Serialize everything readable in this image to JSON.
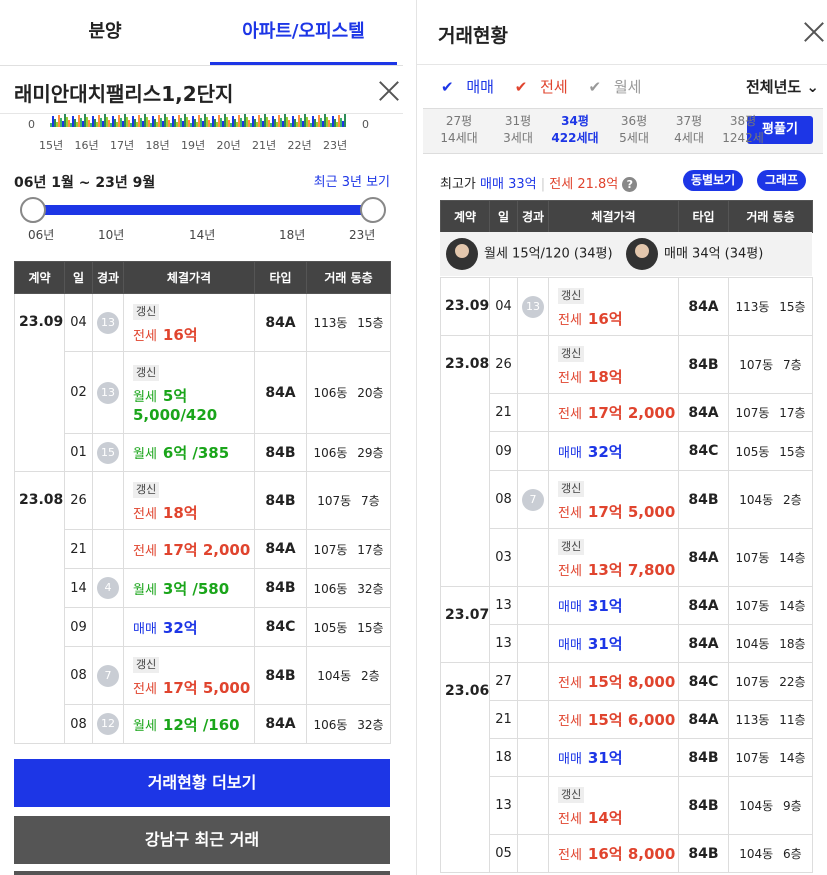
{
  "tabs": {
    "presale": "분양",
    "apt": "아파트/오피스텔"
  },
  "apt_name": "래미안대치팰리스1,2단지",
  "histogram": {
    "axis_min": "0",
    "axis_max": "0",
    "years": [
      "15년",
      "16년",
      "17년",
      "18년",
      "19년",
      "20년",
      "21년",
      "22년",
      "23년"
    ]
  },
  "slider": {
    "range_text": "06년 1월 ~ 23년 9월",
    "recent_link": "최근 3년 보기",
    "labels": [
      "06년",
      "10년",
      "14년",
      "18년",
      "23년"
    ]
  },
  "table_headers": {
    "contract": "계약",
    "day": "일",
    "elapsed": "경과",
    "price": "체결가격",
    "type": "타입",
    "dongfloor": "거래 동층"
  },
  "left_rows": [
    {
      "month": "23.09",
      "day": "04",
      "elapsed": "13",
      "renew": "갱신",
      "kind": "전세",
      "price": "16억",
      "price2": "",
      "cls": "jeon",
      "type": "84A",
      "dong": "113동",
      "floor": "15층"
    },
    {
      "month": "",
      "day": "02",
      "elapsed": "13",
      "renew": "갱신",
      "kind": "월세",
      "price": "5억",
      "price2": "5,000/420",
      "cls": "wol",
      "type": "84A",
      "dong": "106동",
      "floor": "20층"
    },
    {
      "month": "",
      "day": "01",
      "elapsed": "15",
      "renew": "",
      "kind": "월세",
      "price": "6억 /385",
      "price2": "",
      "cls": "wol",
      "type": "84B",
      "dong": "106동",
      "floor": "29층"
    },
    {
      "month": "23.08",
      "day": "26",
      "elapsed": "",
      "renew": "갱신",
      "kind": "전세",
      "price": "18억",
      "price2": "",
      "cls": "jeon",
      "type": "84B",
      "dong": "107동",
      "floor": "7층"
    },
    {
      "month": "",
      "day": "21",
      "elapsed": "",
      "renew": "",
      "kind": "전세",
      "price": "17억 2,000",
      "price2": "",
      "cls": "jeon",
      "type": "84A",
      "dong": "107동",
      "floor": "17층"
    },
    {
      "month": "",
      "day": "14",
      "elapsed": "4",
      "renew": "",
      "kind": "월세",
      "price": "3억 /580",
      "price2": "",
      "cls": "wol",
      "type": "84B",
      "dong": "106동",
      "floor": "32층"
    },
    {
      "month": "",
      "day": "09",
      "elapsed": "",
      "renew": "",
      "kind": "매매",
      "price": "32억",
      "price2": "",
      "cls": "mae",
      "type": "84C",
      "dong": "105동",
      "floor": "15층"
    },
    {
      "month": "",
      "day": "08",
      "elapsed": "7",
      "renew": "갱신",
      "kind": "전세",
      "price": "17억 5,000",
      "price2": "",
      "cls": "jeon",
      "type": "84B",
      "dong": "104동",
      "floor": "2층"
    },
    {
      "month": "",
      "day": "08",
      "elapsed": "12",
      "renew": "",
      "kind": "월세",
      "price": "12억 /160",
      "price2": "",
      "cls": "wol",
      "type": "84A",
      "dong": "106동",
      "floor": "32층"
    }
  ],
  "buttons": {
    "more": "거래현황 더보기",
    "gangnam": "강남구 최근 거래"
  },
  "right": {
    "title": "거래현황",
    "filters": {
      "mae": "매매",
      "jeon": "전세",
      "wol": "월세",
      "year": "전체년도"
    },
    "sizes": [
      {
        "p": "27평",
        "h": "14세대"
      },
      {
        "p": "31평",
        "h": "3세대"
      },
      {
        "p": "34평",
        "h": "422세대"
      },
      {
        "p": "36평",
        "h": "5세대"
      },
      {
        "p": "37평",
        "h": "4세대"
      },
      {
        "p": "38평",
        "h": "1242세"
      }
    ],
    "pyeong_btn": "평풀기",
    "max": {
      "label": "최고가",
      "mae": "매매 33억",
      "jeon": "전세 21.8억",
      "qmark": "?"
    },
    "pills": {
      "dong": "동별보기",
      "graph": "그래프"
    },
    "agents": [
      "월세 15억/120 (34평)",
      "매매 34억 (34평)"
    ],
    "rows": [
      {
        "month": "23.09",
        "day": "04",
        "elapsed": "13",
        "renew": "갱신",
        "kind": "전세",
        "price": "16억",
        "cls": "jeon",
        "type": "84A",
        "dong": "113동",
        "floor": "15층"
      },
      {
        "month": "23.08",
        "day": "26",
        "elapsed": "",
        "renew": "갱신",
        "kind": "전세",
        "price": "18억",
        "cls": "jeon",
        "type": "84B",
        "dong": "107동",
        "floor": "7층"
      },
      {
        "month": "",
        "day": "21",
        "elapsed": "",
        "renew": "",
        "kind": "전세",
        "price": "17억 2,000",
        "cls": "jeon",
        "type": "84A",
        "dong": "107동",
        "floor": "17층"
      },
      {
        "month": "",
        "day": "09",
        "elapsed": "",
        "renew": "",
        "kind": "매매",
        "price": "32억",
        "cls": "mae",
        "type": "84C",
        "dong": "105동",
        "floor": "15층"
      },
      {
        "month": "",
        "day": "08",
        "elapsed": "7",
        "renew": "갱신",
        "kind": "전세",
        "price": "17억 5,000",
        "cls": "jeon",
        "type": "84B",
        "dong": "104동",
        "floor": "2층"
      },
      {
        "month": "",
        "day": "03",
        "elapsed": "",
        "renew": "갱신",
        "kind": "전세",
        "price": "13억 7,800",
        "cls": "jeon",
        "type": "84A",
        "dong": "107동",
        "floor": "14층"
      },
      {
        "month": "23.07",
        "day": "13",
        "elapsed": "",
        "renew": "",
        "kind": "매매",
        "price": "31억",
        "cls": "mae",
        "type": "84A",
        "dong": "107동",
        "floor": "14층"
      },
      {
        "month": "",
        "day": "13",
        "elapsed": "",
        "renew": "",
        "kind": "매매",
        "price": "31억",
        "cls": "mae",
        "type": "84A",
        "dong": "104동",
        "floor": "18층"
      },
      {
        "month": "23.06",
        "day": "27",
        "elapsed": "",
        "renew": "",
        "kind": "전세",
        "price": "15억 8,000",
        "cls": "jeon",
        "type": "84C",
        "dong": "107동",
        "floor": "22층"
      },
      {
        "month": "",
        "day": "21",
        "elapsed": "",
        "renew": "",
        "kind": "전세",
        "price": "15억 6,000",
        "cls": "jeon",
        "type": "84A",
        "dong": "113동",
        "floor": "11층"
      },
      {
        "month": "",
        "day": "18",
        "elapsed": "",
        "renew": "",
        "kind": "매매",
        "price": "31억",
        "cls": "mae",
        "type": "84B",
        "dong": "107동",
        "floor": "14층"
      },
      {
        "month": "",
        "day": "13",
        "elapsed": "",
        "renew": "갱신",
        "kind": "전세",
        "price": "14억",
        "cls": "jeon",
        "type": "84B",
        "dong": "104동",
        "floor": "9층"
      },
      {
        "month": "",
        "day": "05",
        "elapsed": "",
        "renew": "",
        "kind": "전세",
        "price": "16억 8,000",
        "cls": "jeon",
        "type": "84B",
        "dong": "104동",
        "floor": "6층"
      }
    ]
  }
}
